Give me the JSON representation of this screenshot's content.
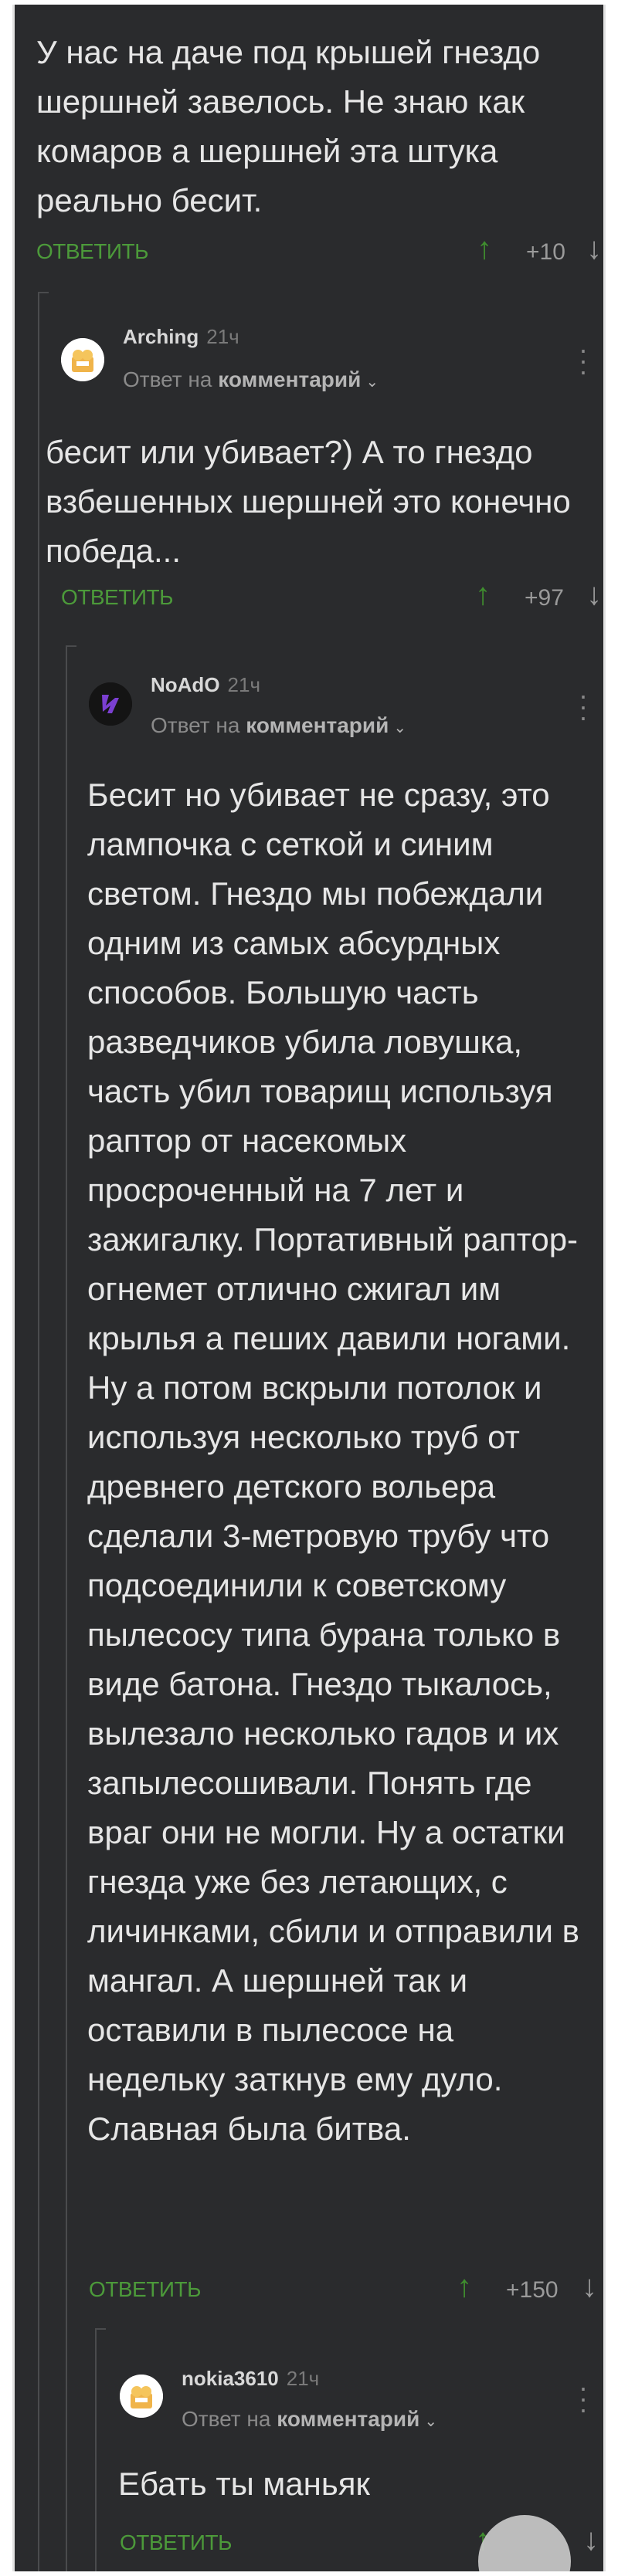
{
  "comments": [
    {
      "text": "У нас на даче под крышей гнездо шершней завелось. Не знаю как комаров а шершней эта штука реально бесит.",
      "reply_label": "ОТВЕТИТЬ",
      "score": "+10"
    },
    {
      "username": "Arching",
      "time": "21ч",
      "meta_prefix": "Ответ на",
      "meta_link": "комментарий",
      "text": "бесит или убивает?) А то гнездо взбешенных шершней это конечно победа...",
      "reply_label": "ОТВЕТИТЬ",
      "score": "+97"
    },
    {
      "username": "NoAdO",
      "time": "21ч",
      "meta_prefix": "Ответ на",
      "meta_link": "комментарий",
      "text": "Бесит но убивает не сразу, это лампочка с сеткой и синим светом. Гнездо мы побеждали одним из самых абсурдных способов. Большую часть разведчиков убила ловушка, часть убил товарищ используя раптор от насекомых просроченный на 7 лет и зажигалку. Портативный раптор-огнемет отлично сжигал им крылья а пеших давили ногами. Ну а потом вскрыли потолок и используя несколько труб от древнего детского вольера сделали 3-метровую трубу что подсоединили к советскому пылесосу типа бурана только в виде батона. Гнездо тыкалось, вылезало несколько гадов и их запылесошивали. Понять где враг они не могли. Ну а остатки гнезда уже без летающих, с личинками, сбили и отправили в мангал. А шершней так и оставили в пылесосе на недельку заткнув ему дуло. Славная была битва.",
      "reply_label": "ОТВЕТИТЬ",
      "score": "+150"
    },
    {
      "username": "nokia3610",
      "time": "21ч",
      "meta_prefix": "Ответ на",
      "meta_link": "комментарий",
      "text": "Ебать ты маньяк",
      "reply_label": "ОТВЕТИТЬ",
      "score": ""
    }
  ],
  "icons": {
    "upvote": "arrow-up-icon",
    "downvote": "arrow-down-icon",
    "more": "more-vertical-icon",
    "chevron": "chevron-down-icon"
  },
  "colors": {
    "background": "#2a2b2d",
    "text": "#e6e6e6",
    "reply": "#4c9a3a",
    "upvote": "#3f8e2e",
    "muted": "#8a8a8a"
  }
}
